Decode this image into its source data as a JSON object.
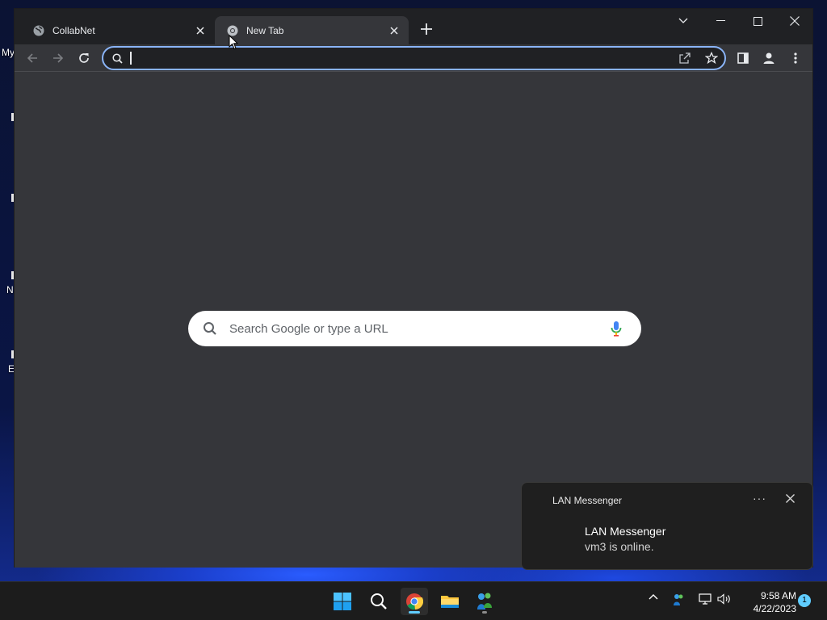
{
  "desktop": {
    "label_my": "My",
    "label_n": "N",
    "label_e": "E"
  },
  "browser": {
    "tabs": [
      {
        "title": "CollabNet",
        "icon": "globe-icon",
        "active": false
      },
      {
        "title": "New Tab",
        "icon": "chrome-icon",
        "active": true
      }
    ],
    "omnibox": {
      "value": "",
      "placeholder": ""
    },
    "ntp_search": {
      "placeholder": "Search Google or type a URL"
    }
  },
  "notification": {
    "app_name": "LAN Messenger",
    "more": "···",
    "title": "LAN Messenger",
    "body": "vm3 is online."
  },
  "taskbar": {
    "apps": [
      "start-icon",
      "search-icon",
      "chrome-icon",
      "file-explorer-icon",
      "lan-messenger-icon"
    ],
    "time": "9:58 AM",
    "date": "4/22/2023",
    "notification_count": "1"
  },
  "colors": {
    "accent": "#8ab4f8",
    "toolbar": "#35363a",
    "tabstrip": "#202124",
    "taskbar_accent": "#60cdff"
  }
}
